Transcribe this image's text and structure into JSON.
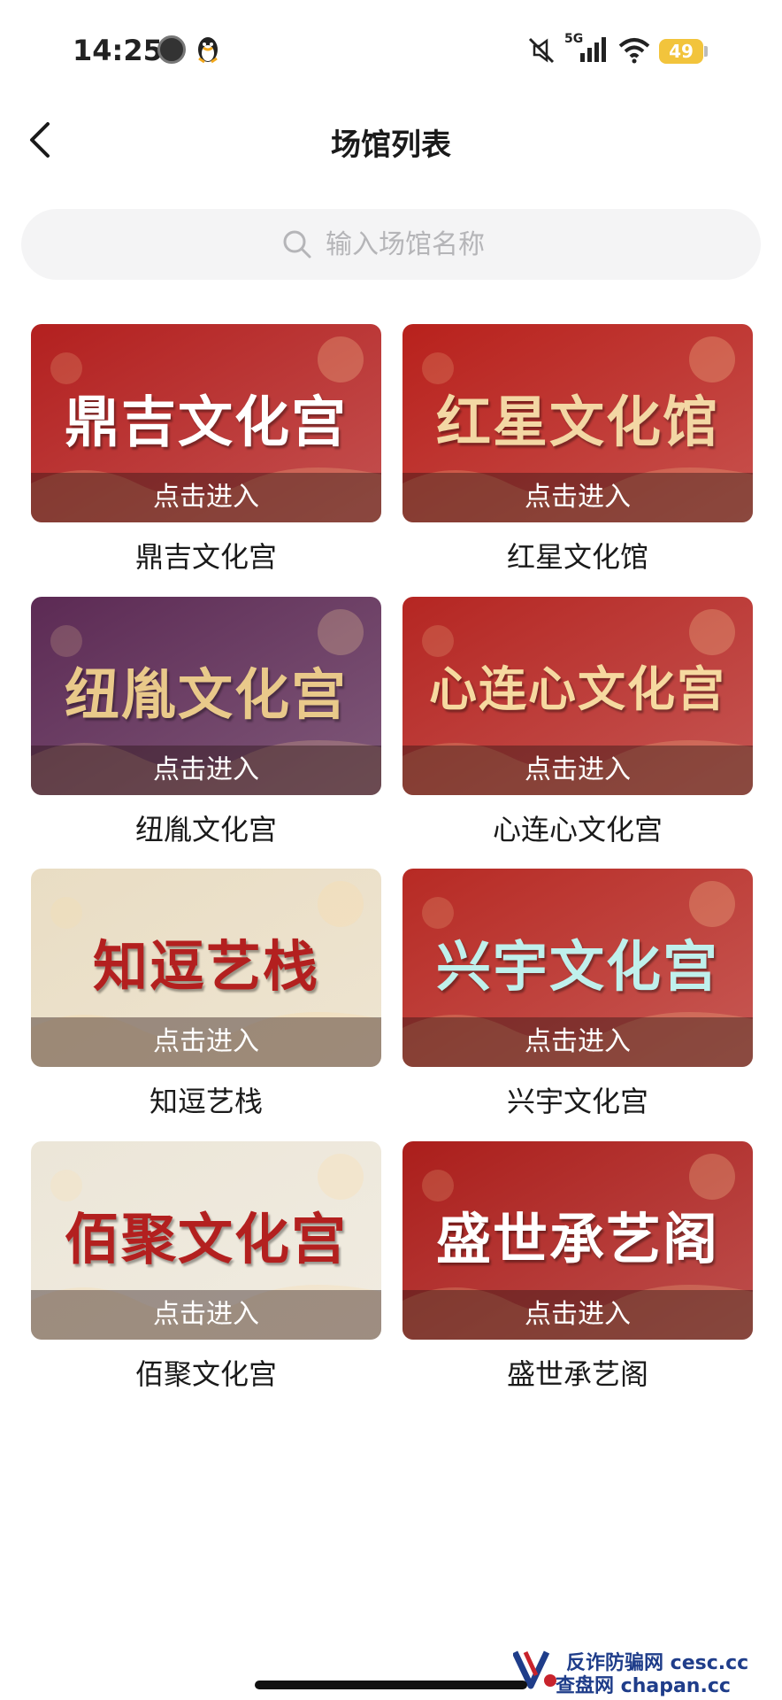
{
  "status_bar": {
    "time": "14:25",
    "network": "5G",
    "battery": "49",
    "icons": [
      "clock-icon",
      "qq-penguin-icon",
      "mute-icon",
      "signal-icon",
      "wifi-icon",
      "battery-icon"
    ]
  },
  "header": {
    "title": "场馆列表",
    "back_icon": "chevron-left-icon"
  },
  "search": {
    "placeholder": "输入场馆名称",
    "value": "",
    "icon": "search-icon"
  },
  "venues": [
    {
      "banner_title": "鼎吉文化宫",
      "enter_label": "点击进入",
      "name": "鼎吉文化宫",
      "bg": "#b3201f",
      "title_color": "#ffffff"
    },
    {
      "banner_title": "红星文化馆",
      "enter_label": "点击进入",
      "name": "红星文化馆",
      "bg": "#b8211c",
      "title_color": "#f3d7a4"
    },
    {
      "banner_title": "纽胤文化宫",
      "enter_label": "点击进入",
      "name": "纽胤文化宫",
      "bg": "#5c2a54",
      "title_color": "#e9c98a"
    },
    {
      "banner_title": "心连心文化宫",
      "enter_label": "点击进入",
      "name": "心连心文化宫",
      "bg": "#b52622",
      "title_color": "#f6d9a0"
    },
    {
      "banner_title": "知逗艺栈",
      "enter_label": "点击进入",
      "name": "知逗艺栈",
      "bg": "#e9ddc4",
      "title_color": "#b3201f"
    },
    {
      "banner_title": "兴宇文化宫",
      "enter_label": "点击进入",
      "name": "兴宇文化宫",
      "bg": "#b72a24",
      "title_color": "#bff0ec"
    },
    {
      "banner_title": "佰聚文化宫",
      "enter_label": "点击进入",
      "name": "佰聚文化宫",
      "bg": "#ece6d8",
      "title_color": "#b3201f"
    },
    {
      "banner_title": "盛世承艺阁",
      "enter_label": "点击进入",
      "name": "盛世承艺阁",
      "bg": "#ab1e1b",
      "title_color": "#ffffff"
    }
  ],
  "watermark": {
    "line1": "反诈防骗网 cesc.cc",
    "line2": "查盘网 chapan.cc"
  }
}
